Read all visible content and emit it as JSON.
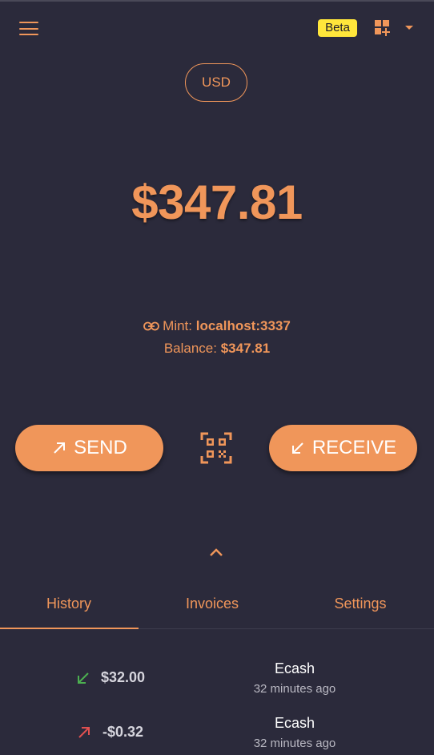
{
  "header": {
    "beta_badge": "Beta"
  },
  "unit": {
    "label": "USD"
  },
  "balance": {
    "display": "$347.81"
  },
  "mint": {
    "prefix": "Mint: ",
    "url": "localhost:3337",
    "balance_prefix": "Balance: ",
    "balance_value": "$347.81"
  },
  "actions": {
    "send_label": "SEND",
    "receive_label": "RECEIVE"
  },
  "tabs": [
    {
      "label": "History",
      "active": true
    },
    {
      "label": "Invoices",
      "active": false
    },
    {
      "label": "Settings",
      "active": false
    }
  ],
  "history": [
    {
      "direction": "incoming",
      "amount": "$32.00",
      "type": "Ecash",
      "time": "32 minutes ago"
    },
    {
      "direction": "outgoing",
      "amount": "-$0.32",
      "type": "Ecash",
      "time": "32 minutes ago"
    }
  ],
  "colors": {
    "background": "#2b2a3b",
    "accent": "#f0965a",
    "beta_badge": "#ffe63b",
    "incoming_arrow": "#4caf50",
    "outgoing_arrow": "#e05050"
  },
  "icons": {
    "menu": "menu-icon",
    "grid": "grid-add-icon",
    "dropdown": "caret-down-icon",
    "link": "link-icon",
    "qr": "qr-code-scanner-icon",
    "expand": "chevron-up-icon",
    "send": "arrow-up-right-icon",
    "receive": "arrow-down-left-icon"
  }
}
